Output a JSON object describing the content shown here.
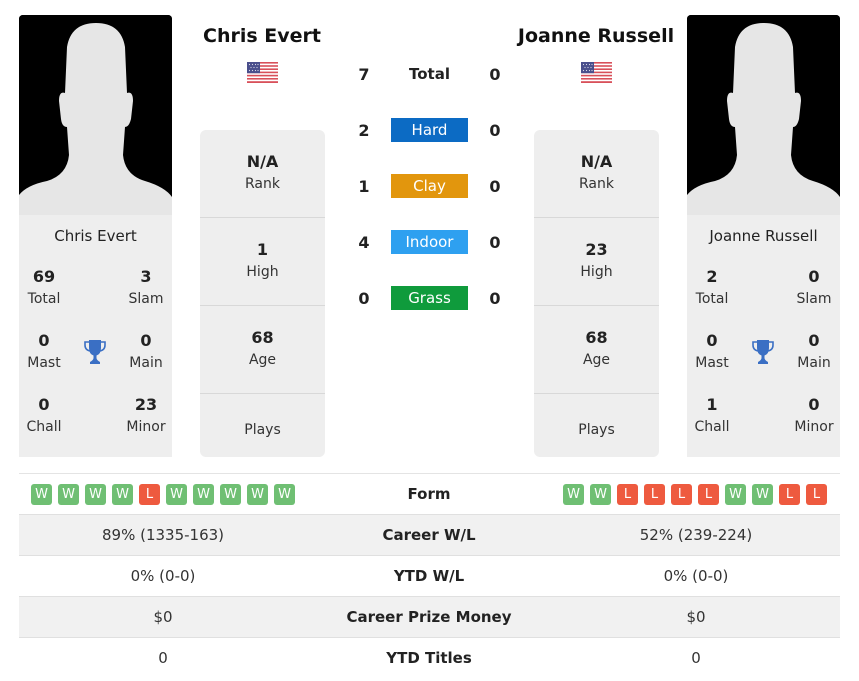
{
  "player_left": {
    "name": "Chris Evert",
    "country": "USA",
    "titles": {
      "total": "69",
      "slam": "3",
      "mast": "0",
      "main": "0",
      "chall": "0",
      "minor": "23"
    },
    "rank": "N/A",
    "high": "1",
    "age": "68",
    "plays": "",
    "form": [
      "W",
      "W",
      "W",
      "W",
      "L",
      "W",
      "W",
      "W",
      "W",
      "W"
    ]
  },
  "player_right": {
    "name": "Joanne Russell",
    "country": "USA",
    "titles": {
      "total": "2",
      "slam": "0",
      "mast": "0",
      "main": "0",
      "chall": "1",
      "minor": "0"
    },
    "rank": "N/A",
    "high": "23",
    "age": "68",
    "plays": "",
    "form": [
      "W",
      "W",
      "L",
      "L",
      "L",
      "L",
      "W",
      "W",
      "L",
      "L"
    ]
  },
  "labels": {
    "total": "Total",
    "slam": "Slam",
    "mast": "Mast",
    "main": "Main",
    "chall": "Chall",
    "minor": "Minor",
    "rank": "Rank",
    "high": "High",
    "age": "Age",
    "plays": "Plays",
    "form": "Form"
  },
  "h2h": [
    {
      "label": "Total",
      "left": "7",
      "right": "0",
      "color": ""
    },
    {
      "label": "Hard",
      "left": "2",
      "right": "0",
      "color": "#0c6bc4"
    },
    {
      "label": "Clay",
      "left": "1",
      "right": "0",
      "color": "#e2960d"
    },
    {
      "label": "Indoor",
      "left": "4",
      "right": "0",
      "color": "#2ea0f0"
    },
    {
      "label": "Grass",
      "left": "0",
      "right": "0",
      "color": "#0f9b3c"
    }
  ],
  "stats": [
    {
      "label": "Career W/L",
      "left": "89% (1335-163)",
      "right": "52% (239-224)"
    },
    {
      "label": "YTD W/L",
      "left": "0% (0-0)",
      "right": "0% (0-0)"
    },
    {
      "label": "Career Prize Money",
      "left": "$0",
      "right": "$0"
    },
    {
      "label": "YTD Titles",
      "left": "0",
      "right": "0"
    }
  ],
  "colors": {
    "win": "#6fbf73",
    "loss": "#ee5a3f",
    "trophy": "#3a6fc4"
  }
}
